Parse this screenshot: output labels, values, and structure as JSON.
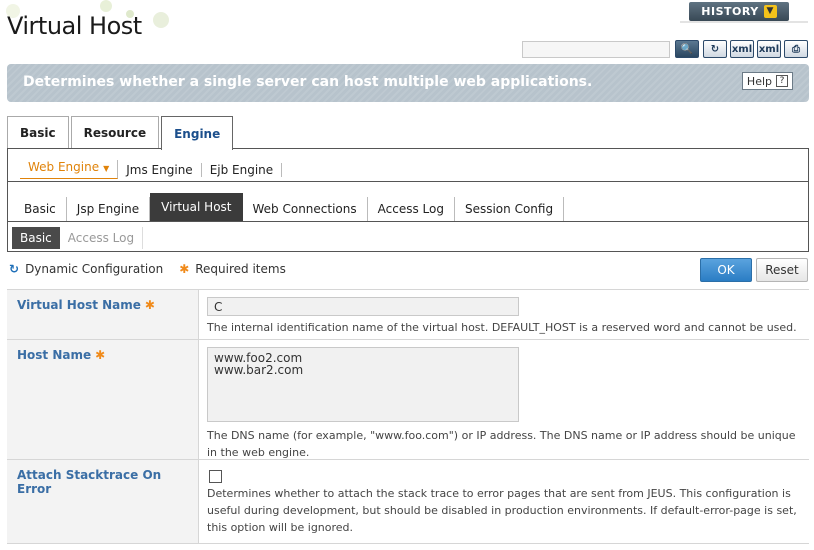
{
  "page": {
    "title": "Virtual Host",
    "history_label": "HISTORY"
  },
  "toolbar": {
    "search_placeholder": "",
    "buttons": [
      "search-icon",
      "refresh-icon",
      "export-xml-icon",
      "import-xml-icon",
      "print-icon"
    ]
  },
  "banner": {
    "text": "Determines whether a single server can host multiple web applications.",
    "help_label": "Help"
  },
  "tabs_primary": [
    {
      "label": "Basic"
    },
    {
      "label": "Resource"
    },
    {
      "label": "Engine",
      "active": true
    }
  ],
  "engine_nav": [
    {
      "label": "Web Engine",
      "active": true
    },
    {
      "label": "Jms Engine"
    },
    {
      "label": "Ejb Engine"
    }
  ],
  "tabs_web": [
    {
      "label": "Basic"
    },
    {
      "label": "Jsp Engine"
    },
    {
      "label": "Virtual Host",
      "active": true
    },
    {
      "label": "Web Connections"
    },
    {
      "label": "Access Log"
    },
    {
      "label": "Session Config"
    }
  ],
  "tabs_vhost": [
    {
      "label": "Basic",
      "active": true
    },
    {
      "label": "Access Log"
    }
  ],
  "legend": {
    "dynamic": "Dynamic Configuration",
    "required": "Required items"
  },
  "actions": {
    "ok": "OK",
    "reset": "Reset"
  },
  "form": {
    "virtual_host_name": {
      "label": "Virtual Host Name",
      "value": "C",
      "desc": "The internal identification name of the virtual host. DEFAULT_HOST is a reserved word and cannot be used."
    },
    "host_name": {
      "label": "Host Name",
      "value": "www.foo2.com\nwww.bar2.com",
      "desc": "The DNS name (for example, \"www.foo.com\") or IP address. The DNS name or IP address should be unique in the web engine."
    },
    "attach_stacktrace": {
      "label": "Attach Stacktrace On Error",
      "checked": false,
      "desc": "Determines whether to attach the stack trace to error pages that are sent from JEUS. This configuration is useful during development, but should be disabled in production environments. If default-error-page is set, this option will be ignored."
    }
  },
  "colors": {
    "label_blue": "#3a6ea5",
    "accent_orange": "#e0830a",
    "ok_blue": "#2b7dc4",
    "banner_gray": "#b7c3cc"
  }
}
